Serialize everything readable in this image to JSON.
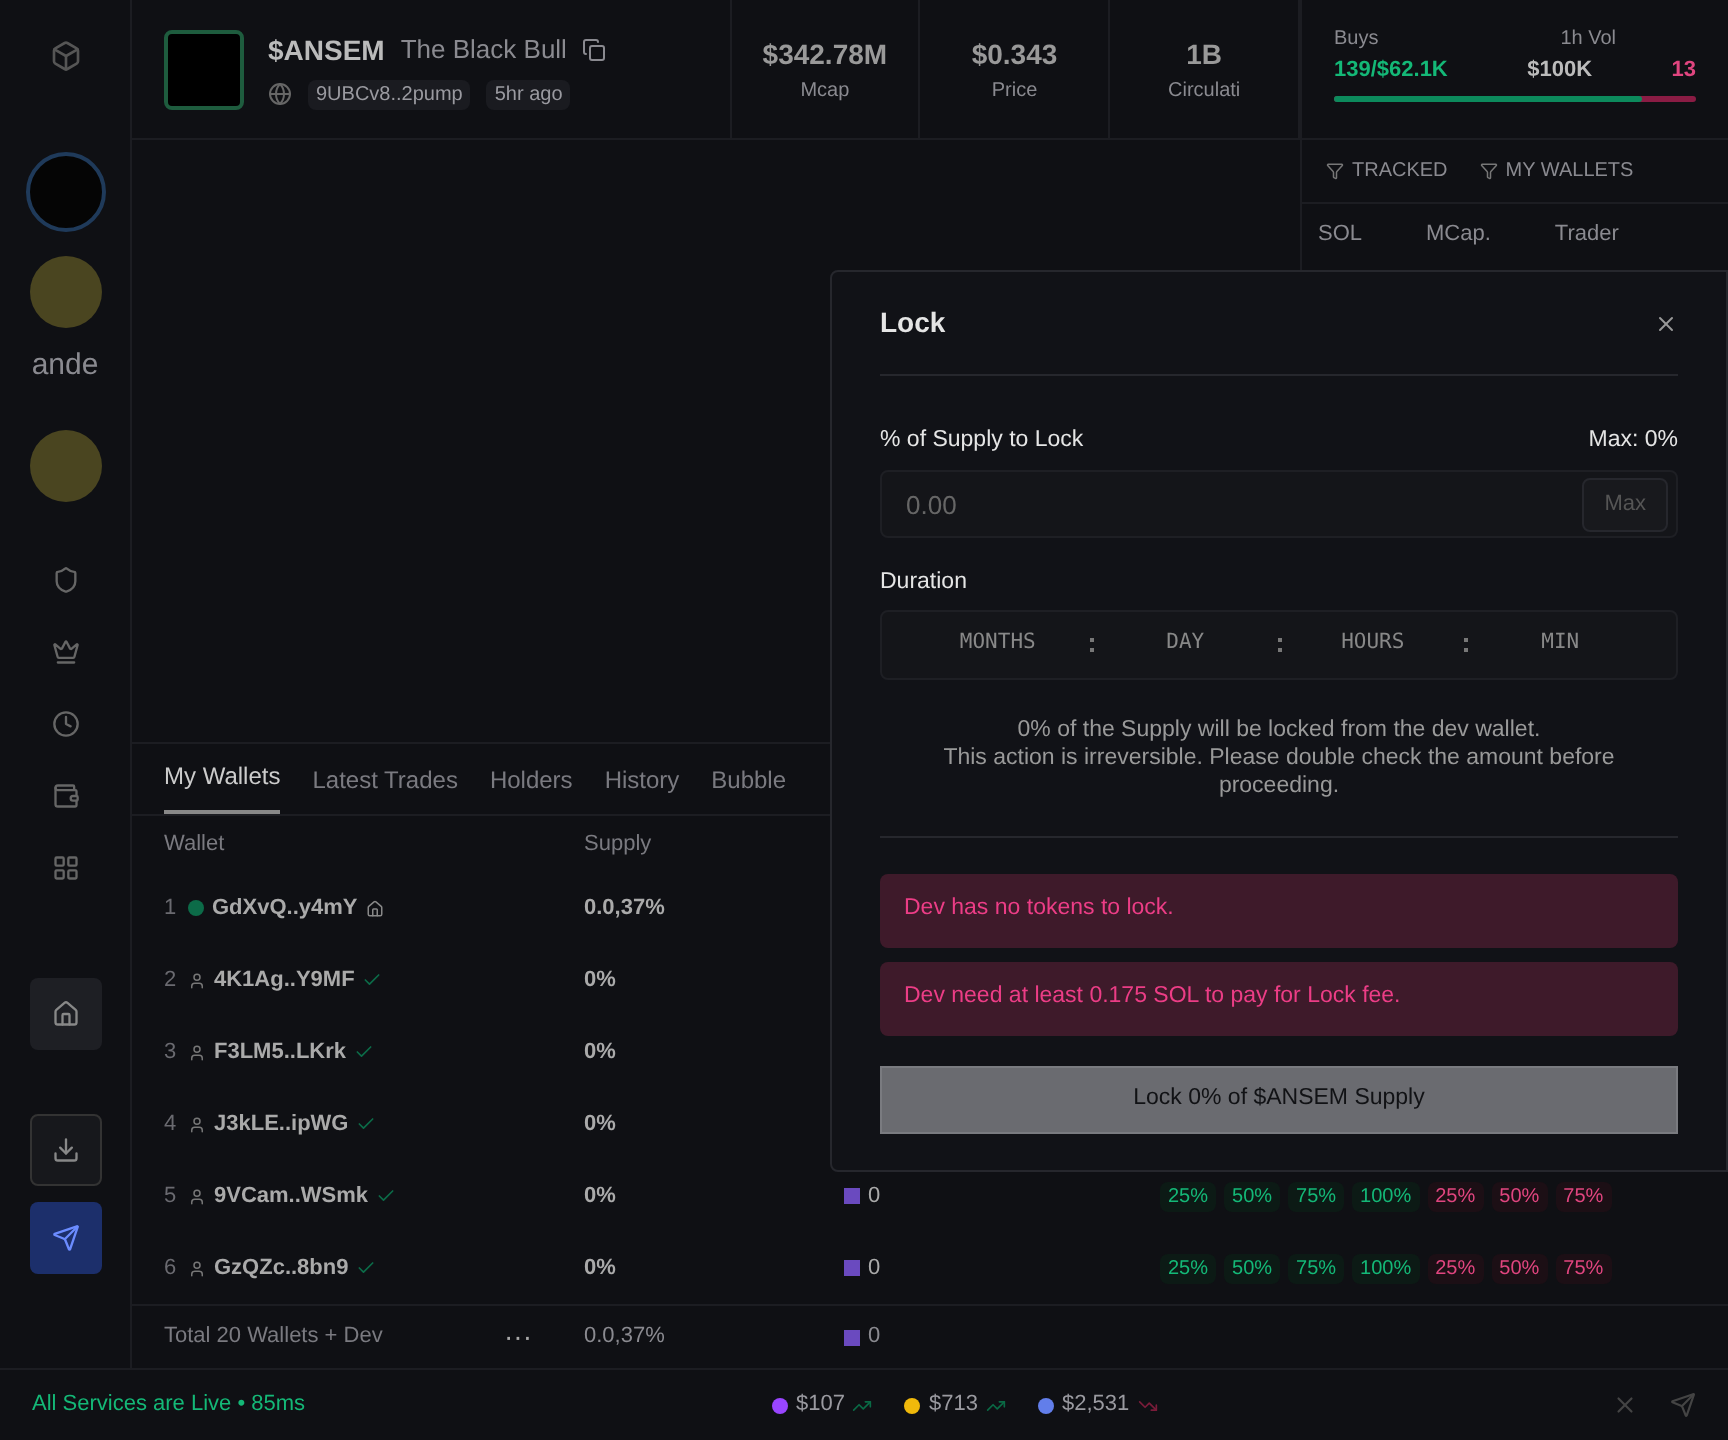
{
  "sidebar": {
    "label": "ande"
  },
  "token": {
    "symbol": "$ANSEM",
    "name": "The Black Bull",
    "address": "9UBCv8..2pump",
    "age": "5hr ago"
  },
  "stats": [
    {
      "value": "$342.78M",
      "label": "Mcap"
    },
    {
      "value": "$0.343",
      "label": "Price"
    },
    {
      "value": "1B",
      "label": "Circulati"
    }
  ],
  "flow": {
    "buys_label": "Buys",
    "buys": "139/$62.1K",
    "vol_label": "1h Vol",
    "vol": "$100K",
    "sells": "13",
    "buy_bar": {
      "level": 0.85
    }
  },
  "filters": [
    "TRACKED",
    "MY WALLETS"
  ],
  "trade_columns": [
    "SOL",
    "MCap.",
    "Trader"
  ],
  "table": {
    "tabs": [
      {
        "label": "My Wallets",
        "selected": true
      },
      {
        "label": "Latest Trades",
        "selected": false
      },
      {
        "label": "Holders",
        "selected": false
      },
      {
        "label": "History",
        "selected": false
      },
      {
        "label": "Bubble",
        "selected": false
      }
    ],
    "columns": [
      "Wallet",
      "Supply"
    ],
    "rows": [
      {
        "index": "1",
        "wallet": "GdXvQ..y4mY",
        "kind": "dev",
        "supply": "0.0,37%"
      },
      {
        "index": "2",
        "wallet": "4K1Ag..Y9MF",
        "kind": "wallet",
        "supply": "0%"
      },
      {
        "index": "3",
        "wallet": "F3LM5..LKrk",
        "kind": "wallet",
        "supply": "0%"
      },
      {
        "index": "4",
        "wallet": "J3kLE..ipWG",
        "kind": "wallet",
        "supply": "0%"
      },
      {
        "index": "5",
        "wallet": "9VCam..WSmk",
        "kind": "wallet",
        "supply": "0%",
        "amount": "0",
        "quick": [
          {
            "label": "25%",
            "kind": "buy"
          },
          {
            "label": "50%",
            "kind": "buy"
          },
          {
            "label": "75%",
            "kind": "buy"
          },
          {
            "label": "100%",
            "kind": "buy"
          },
          {
            "label": "25%",
            "kind": "sell"
          },
          {
            "label": "50%",
            "kind": "sell"
          },
          {
            "label": "75%",
            "kind": "sell"
          }
        ]
      },
      {
        "index": "6",
        "wallet": "GzQZc..8bn9",
        "kind": "wallet",
        "supply": "0%",
        "amount": "0",
        "quick": [
          {
            "label": "25%",
            "kind": "buy"
          },
          {
            "label": "50%",
            "kind": "buy"
          },
          {
            "label": "75%",
            "kind": "buy"
          },
          {
            "label": "100%",
            "kind": "buy"
          },
          {
            "label": "25%",
            "kind": "sell"
          },
          {
            "label": "50%",
            "kind": "sell"
          },
          {
            "label": "75%",
            "kind": "sell"
          }
        ]
      }
    ],
    "total": {
      "label": "Total 20 Wallets + Dev",
      "dots": "···",
      "supply": "0.0,37%",
      "amount": "0"
    }
  },
  "status_bar": {
    "status": "All Services are Live • 85ms",
    "prices": [
      {
        "value": "$107",
        "kind": "up",
        "color": "#9945ff"
      },
      {
        "value": "$713",
        "kind": "up",
        "color": "#f0b90b"
      },
      {
        "value": "$2,531",
        "kind": "down",
        "color": "#627eea"
      }
    ]
  },
  "modal": {
    "title": "Lock",
    "supply_label": "% of Supply to Lock",
    "max_label": "Max: 0%",
    "input": {
      "placeholder": "0.00"
    },
    "max_button": "Max",
    "duration_label": "Duration",
    "duration_fields": [
      {
        "placeholder": "MONTHS"
      },
      {
        "placeholder": "DAY"
      },
      {
        "placeholder": "HOURS"
      },
      {
        "placeholder": "MIN"
      }
    ],
    "note": [
      "0% of the Supply will be locked from the dev wallet.",
      "This action is irreversible. Please double check the amount before proceeding."
    ],
    "errors": [
      "Dev has no tokens to lock.",
      "Dev need at least 0.175 SOL to pay for Lock fee."
    ],
    "submit": {
      "label": "Lock 0% of $ANSEM Supply",
      "disabled": true
    }
  }
}
